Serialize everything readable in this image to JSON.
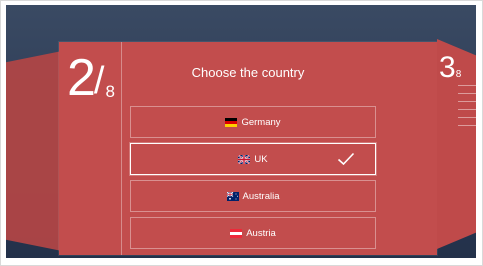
{
  "step": {
    "current": "2",
    "slash": "/",
    "total": "8"
  },
  "next_step": {
    "current": "3",
    "total": "8"
  },
  "title": "Choose the country",
  "countries": [
    {
      "label": "Germany",
      "flag": "germany-flag-icon",
      "selected": false
    },
    {
      "label": "UK",
      "flag": "uk-flag-icon",
      "selected": true
    },
    {
      "label": "Australia",
      "flag": "australia-flag-icon",
      "selected": false
    },
    {
      "label": "Austria",
      "flag": "austria-flag-icon",
      "selected": false
    }
  ],
  "colors": {
    "card": "#c24d4d",
    "background": "#2c3b55",
    "text": "#ffffff"
  }
}
